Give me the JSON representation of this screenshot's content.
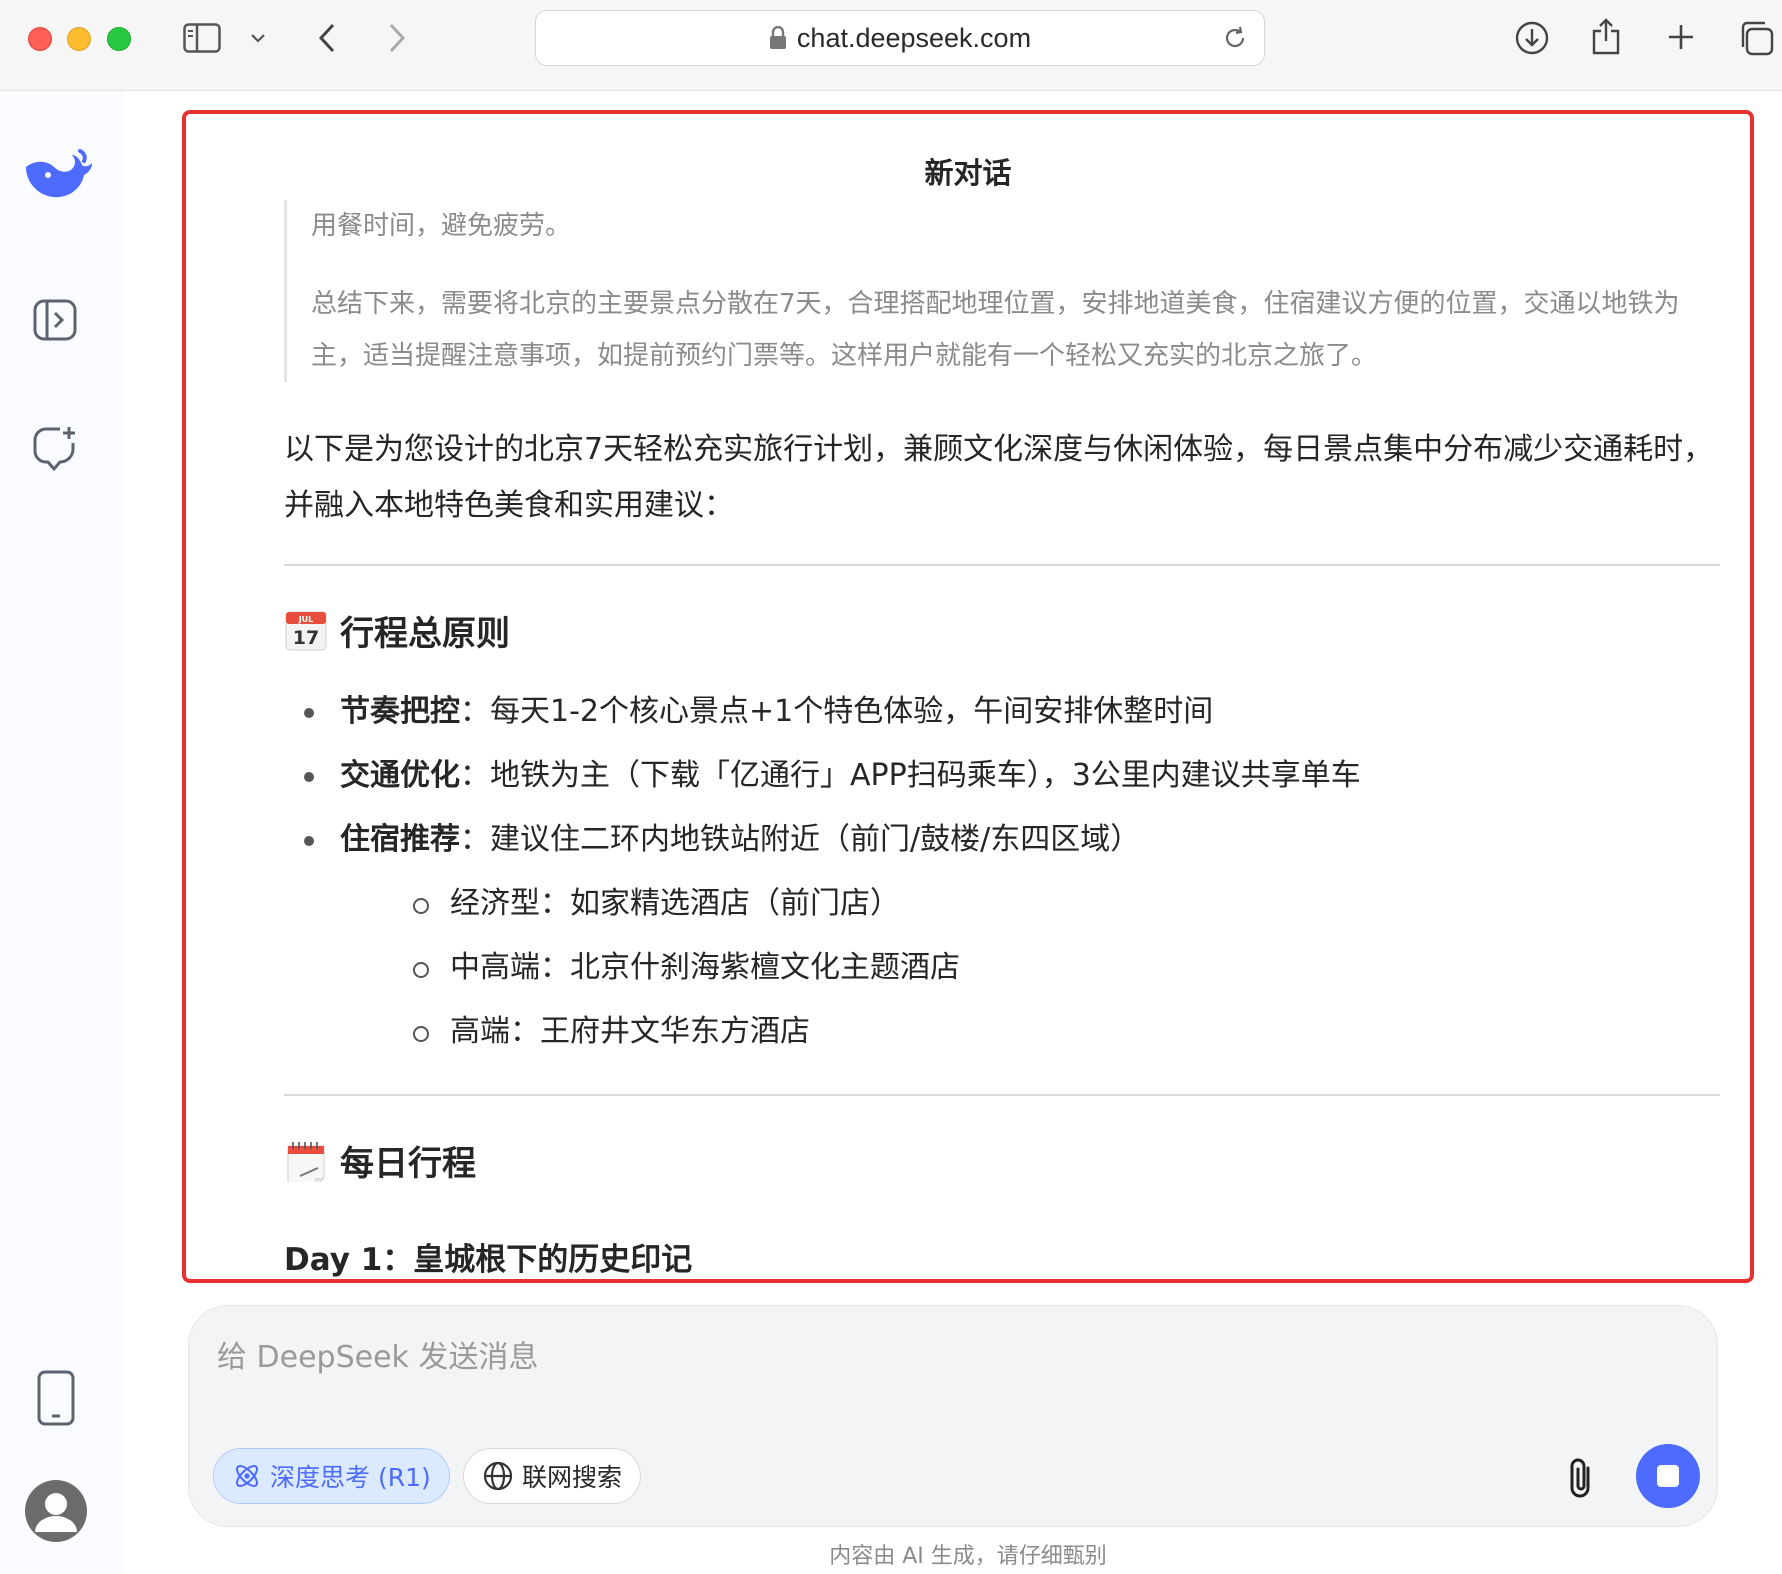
{
  "browser": {
    "url": "chat.deepseek.com"
  },
  "chat": {
    "title": "新对话",
    "thinking": [
      "用餐时间，避免疲劳。",
      "总结下来，需要将北京的主要景点分散在7天，合理搭配地理位置，安排地道美食，住宿建议方便的位置，交通以地铁为主，适当提醒注意事项，如提前预约门票等。这样用户就能有一个轻松又充实的北京之旅了。"
    ],
    "intro": "以下是为您设计的北京7天轻松充实旅行计划，兼顾文化深度与休闲体验，每日景点集中分布减少交通耗时，并融入本地特色美食和实用建议：",
    "section1": {
      "title": "行程总原则",
      "emoji_icon": "calendar-icon",
      "calendar_month": "JUL",
      "calendar_day": "17",
      "items": [
        {
          "label": "节奏把控",
          "text": "：每天1-2个核心景点+1个特色体验，午间安排休整时间"
        },
        {
          "label": "交通优化",
          "text": "：地铁为主（下载「亿通行」APP扫码乘车），3公里内建议共享单车"
        },
        {
          "label": "住宿推荐",
          "text": "：建议住二环内地铁站附近（前门/鼓楼/东四区域）"
        }
      ],
      "sub_items": [
        "经济型：如家精选酒店（前门店）",
        "中高端：北京什刹海紫檀文化主题酒店",
        "高端：王府井文华东方酒店"
      ]
    },
    "section2": {
      "title": "每日行程",
      "emoji_icon": "spiral-calendar-icon"
    },
    "day1": "Day 1：皇城根下的历史印记"
  },
  "input": {
    "placeholder": "给 DeepSeek 发送消息",
    "deep_think_label": "深度思考 (R1)",
    "web_search_label": "联网搜索"
  },
  "footer": {
    "note": "内容由 AI 生成，请仔细甄别"
  },
  "colors": {
    "accent": "#4d6bfe",
    "highlight": "#e8312f"
  }
}
